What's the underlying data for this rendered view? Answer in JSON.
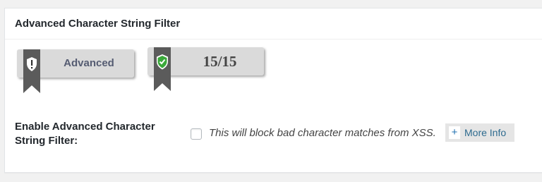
{
  "panel": {
    "title": "Advanced Character String Filter"
  },
  "badges": {
    "level": {
      "label": "Advanced",
      "icon": "shield-exclamation-icon"
    },
    "score": {
      "label": "15/15",
      "icon": "shield-check-icon",
      "icon_color": "#3aa83a"
    }
  },
  "option": {
    "label": "Enable Advanced Character String Filter:",
    "checked": false,
    "description": "This will block bad character matches from XSS.",
    "more_info_symbol": "+",
    "more_info_label": "More Info"
  },
  "colors": {
    "background": "#f1f1f1",
    "panel": "#ffffff",
    "badge": "#dadada",
    "ribbon": "#5b5b5b",
    "link": "#2e6b8f"
  }
}
